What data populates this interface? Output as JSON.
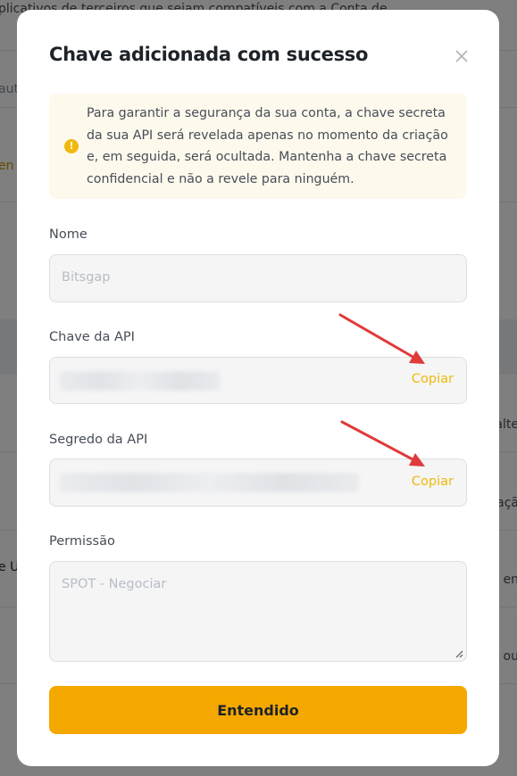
{
  "background": {
    "top_text": "plicativos de terceiros que sejam compatíveis com a Conta de",
    "left_snippets": [
      "aut",
      "en",
      "e U"
    ],
    "right_snippets": [
      "alte",
      "açã",
      "; en",
      "r ou"
    ]
  },
  "modal": {
    "title": "Chave adicionada com sucesso",
    "close_icon": "close-icon",
    "alert": {
      "icon": "info-icon",
      "icon_glyph": "!",
      "text": "Para garantir a segurança da sua conta, a chave secreta da sua API será revelada apenas no momento da criação e, em seguida, será ocultada. Mantenha a chave secreta confidencial e não a revele para ninguém."
    },
    "fields": {
      "name": {
        "label": "Nome",
        "placeholder": "Bitsgap"
      },
      "api_key": {
        "label": "Chave da API",
        "copy_label": "Copiar"
      },
      "api_secret": {
        "label": "Segredo da API",
        "copy_label": "Copiar"
      },
      "permission": {
        "label": "Permissão",
        "placeholder": "SPOT - Negociar"
      }
    },
    "confirm_button": "Entendido"
  },
  "colors": {
    "accent": "#f0b90b",
    "button": "#f5a800",
    "alert_bg": "#fef9ed",
    "arrow": "#e03a3a"
  }
}
